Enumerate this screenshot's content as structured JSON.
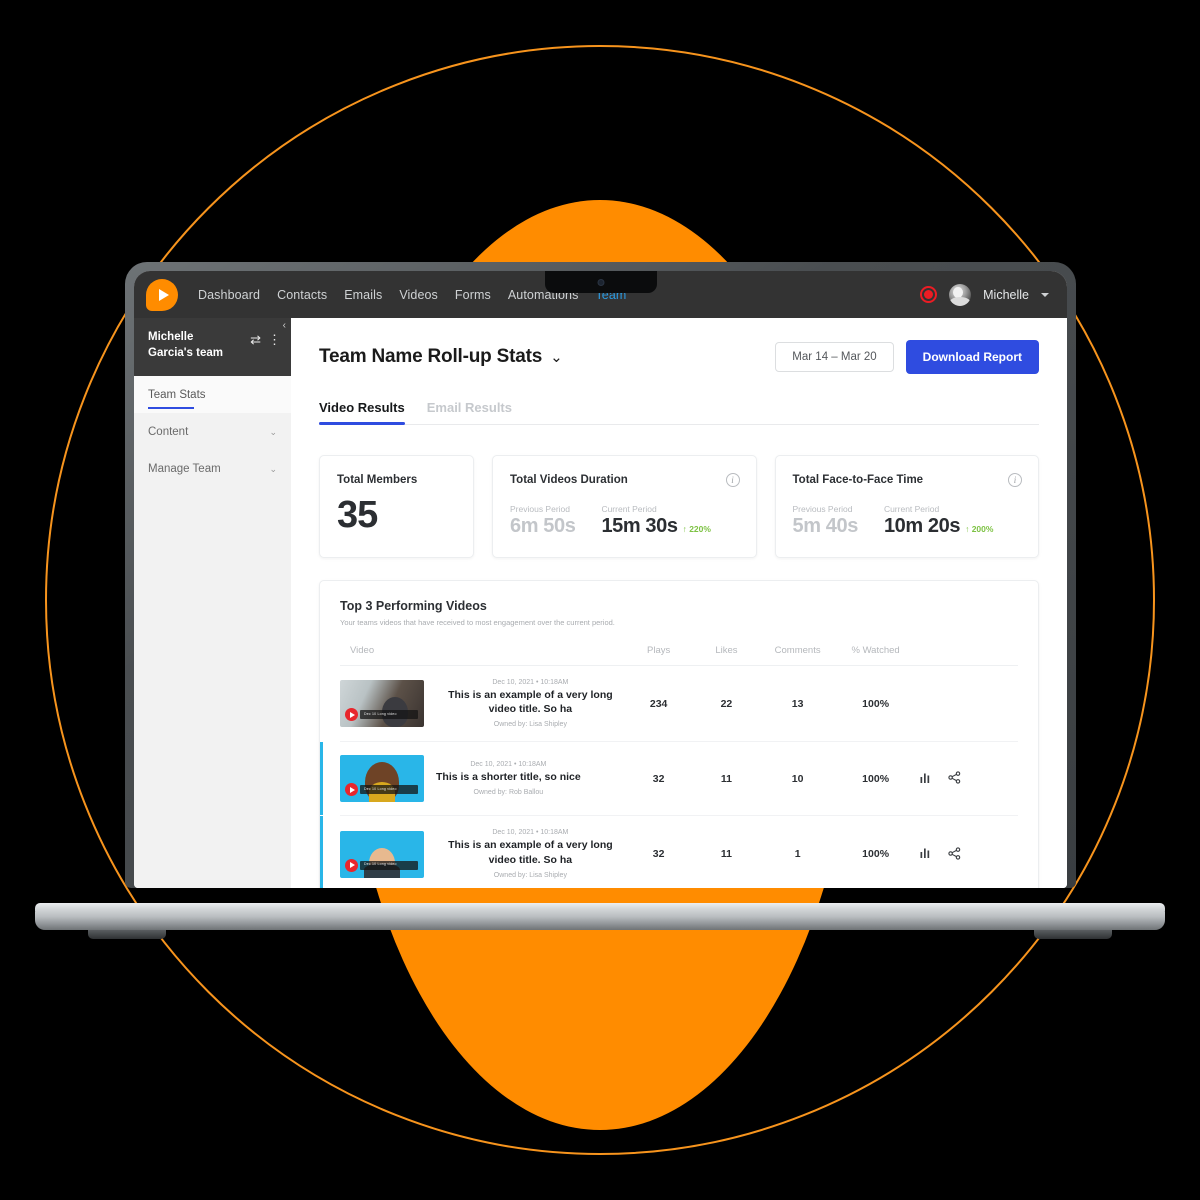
{
  "theme": {
    "background": "#000000",
    "accent_orange": "#FF8C00",
    "ring_orange": "#F7941D",
    "brand_blue": "#2F4CE0",
    "link_blue": "#2F6CE0",
    "teal_accent": "#29B6E8",
    "positive_green": "#7DC243",
    "nav_dark": "#333333",
    "record_red": "#EC1C24"
  },
  "topnav": {
    "logo_icon": "play-bubble-logo",
    "links": [
      {
        "label": "Dashboard",
        "active": false
      },
      {
        "label": "Contacts",
        "active": false
      },
      {
        "label": "Emails",
        "active": false
      },
      {
        "label": "Videos",
        "active": false
      },
      {
        "label": "Forms",
        "active": false
      },
      {
        "label": "Automations",
        "active": false
      },
      {
        "label": "Team",
        "active": true
      }
    ],
    "record_icon": "record-icon",
    "avatar_icon": "user-avatar",
    "username": "Michelle",
    "caret_icon": "chevron-down-icon"
  },
  "sidebar": {
    "team_name": "Michelle Garcia's team",
    "swap_icon": "swap-teams-icon",
    "swap_glyph": "⇄",
    "more_icon": "more-vertical-icon",
    "more_glyph": "⋮",
    "collapse_icon": "collapse-sidebar-icon",
    "collapse_glyph": "‹",
    "items": [
      {
        "label": "Team Stats",
        "active": true,
        "expandable": false
      },
      {
        "label": "Content",
        "active": false,
        "expandable": true
      },
      {
        "label": "Manage Team",
        "active": false,
        "expandable": true
      }
    ],
    "chevron_glyph": "⌄"
  },
  "page": {
    "title": "Team Name Roll-up Stats",
    "title_caret_glyph": "⌄",
    "date_range": "Mar 14 – Mar 20",
    "download_label": "Download Report",
    "tabs": [
      {
        "label": "Video Results",
        "active": true
      },
      {
        "label": "Email Results",
        "active": false
      }
    ]
  },
  "cards": {
    "members": {
      "title": "Total Members",
      "value": "35"
    },
    "videos_duration": {
      "title": "Total Videos Duration",
      "info_icon": "info-icon",
      "previous_label": "Previous Period",
      "previous_value": "6m 50s",
      "current_label": "Current Period",
      "current_value": "15m 30s",
      "delta": "↑ 220%"
    },
    "face_time": {
      "title": "Total Face-to-Face Time",
      "info_icon": "info-icon",
      "previous_label": "Previous Period",
      "previous_value": "5m 40s",
      "current_label": "Current Period",
      "current_value": "10m 20s",
      "delta": "↑ 200%"
    }
  },
  "videos_panel": {
    "title": "Top 3 Performing Videos",
    "subtitle": "Your teams videos that have received to most engagement over the current period.",
    "columns": [
      "Video",
      "Plays",
      "Likes",
      "Comments",
      "% Watched",
      ""
    ],
    "rows": [
      {
        "date": "Dec 10, 2021 • 10:18AM",
        "title": "This is an example of a very long video title. So ha",
        "owner": "Owned by: Lisa Shipley",
        "plays": "234",
        "likes": "22",
        "comments": "13",
        "watched": "100%",
        "thumb_overlay_text": "Dec 10 Long video",
        "show_actions": false
      },
      {
        "date": "Dec 10, 2021 • 10:18AM",
        "title": "This is a shorter title, so nice",
        "owner": "Owned by: Rob Ballou",
        "plays": "32",
        "likes": "11",
        "comments": "10",
        "watched": "100%",
        "thumb_overlay_text": "Dec 10 Long video",
        "show_actions": true
      },
      {
        "date": "Dec 10, 2021 • 10:18AM",
        "title": "This is an example of a very long video title. So ha",
        "owner": "Owned by: Lisa Shipley",
        "plays": "32",
        "likes": "11",
        "comments": "1",
        "watched": "100%",
        "thumb_overlay_text": "Dec 10 Long video",
        "show_actions": true
      }
    ],
    "action_icons": {
      "stats_icon": "bar-chart-icon",
      "stats_glyph": "ıl|",
      "share_icon": "share-icon"
    }
  }
}
